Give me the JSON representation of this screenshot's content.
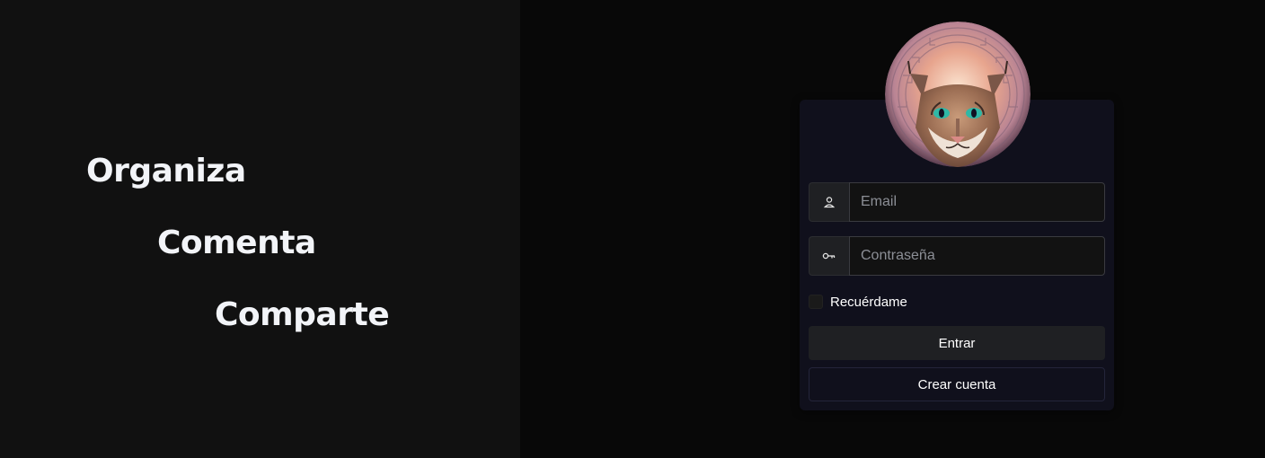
{
  "slogans": {
    "line1": "Organiza",
    "line2": "Comenta",
    "line3": "Comparte"
  },
  "login": {
    "email_placeholder": "Email",
    "email_value": "",
    "password_placeholder": "Contraseña",
    "password_value": "",
    "email_icon": "user-icon",
    "password_icon": "key-icon",
    "remember_label": "Recuérdame",
    "remember_checked": false,
    "submit_label": "Entrar",
    "create_account_label": "Crear cuenta"
  },
  "colors": {
    "left_background": "#111111",
    "right_background": "#080808",
    "card_background": "#10101c",
    "text": "#ffffff"
  }
}
